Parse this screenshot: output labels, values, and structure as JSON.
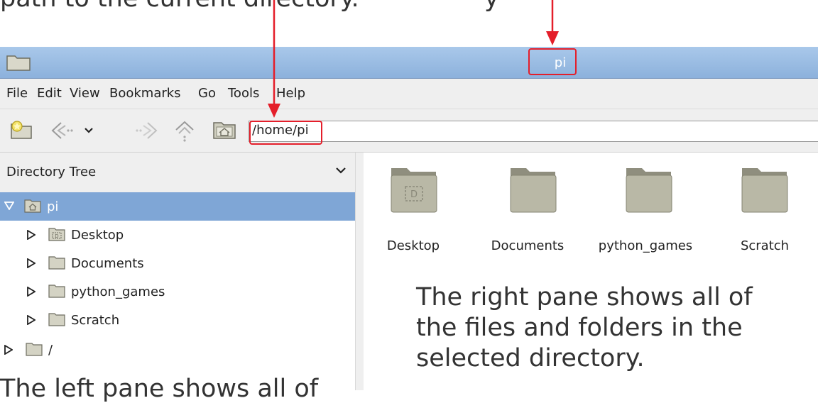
{
  "captions": {
    "top_left": "path to the current directory.",
    "top_right": "y",
    "right": [
      "The right pane shows all of",
      "the files and folders in the",
      "selected directory."
    ],
    "bottom_left": "The left pane shows all of"
  },
  "window": {
    "title": "pi"
  },
  "menu": [
    "File",
    "Edit",
    "View",
    "Bookmarks",
    "Go",
    "Tools",
    "Help"
  ],
  "toolbar": {
    "path": "/home/pi",
    "icons": [
      "new-tab-icon",
      "back-icon",
      "history-dropdown-icon",
      "forward-icon",
      "up-icon",
      "home-icon"
    ]
  },
  "sidebar": {
    "header": "Directory Tree",
    "items": [
      {
        "label": "pi",
        "level": 0,
        "expanded": true,
        "selected": true,
        "icon": "home-folder"
      },
      {
        "label": "Desktop",
        "level": 1,
        "expanded": false,
        "selected": false,
        "icon": "desktop-folder"
      },
      {
        "label": "Documents",
        "level": 1,
        "expanded": false,
        "selected": false,
        "icon": "folder"
      },
      {
        "label": "python_games",
        "level": 1,
        "expanded": false,
        "selected": false,
        "icon": "folder"
      },
      {
        "label": "Scratch",
        "level": 1,
        "expanded": false,
        "selected": false,
        "icon": "folder"
      },
      {
        "label": "/",
        "level": 0,
        "expanded": false,
        "selected": false,
        "icon": "folder"
      }
    ]
  },
  "files": [
    {
      "name": "Desktop",
      "icon": "desktop-folder"
    },
    {
      "name": "Documents",
      "icon": "folder"
    },
    {
      "name": "python_games",
      "icon": "folder"
    },
    {
      "name": "Scratch",
      "icon": "folder"
    }
  ],
  "colors": {
    "highlight": "#e41e2a",
    "selection": "#7fa6d6",
    "titlebar": "#9bbde3",
    "folder": "#b9b8a6"
  }
}
